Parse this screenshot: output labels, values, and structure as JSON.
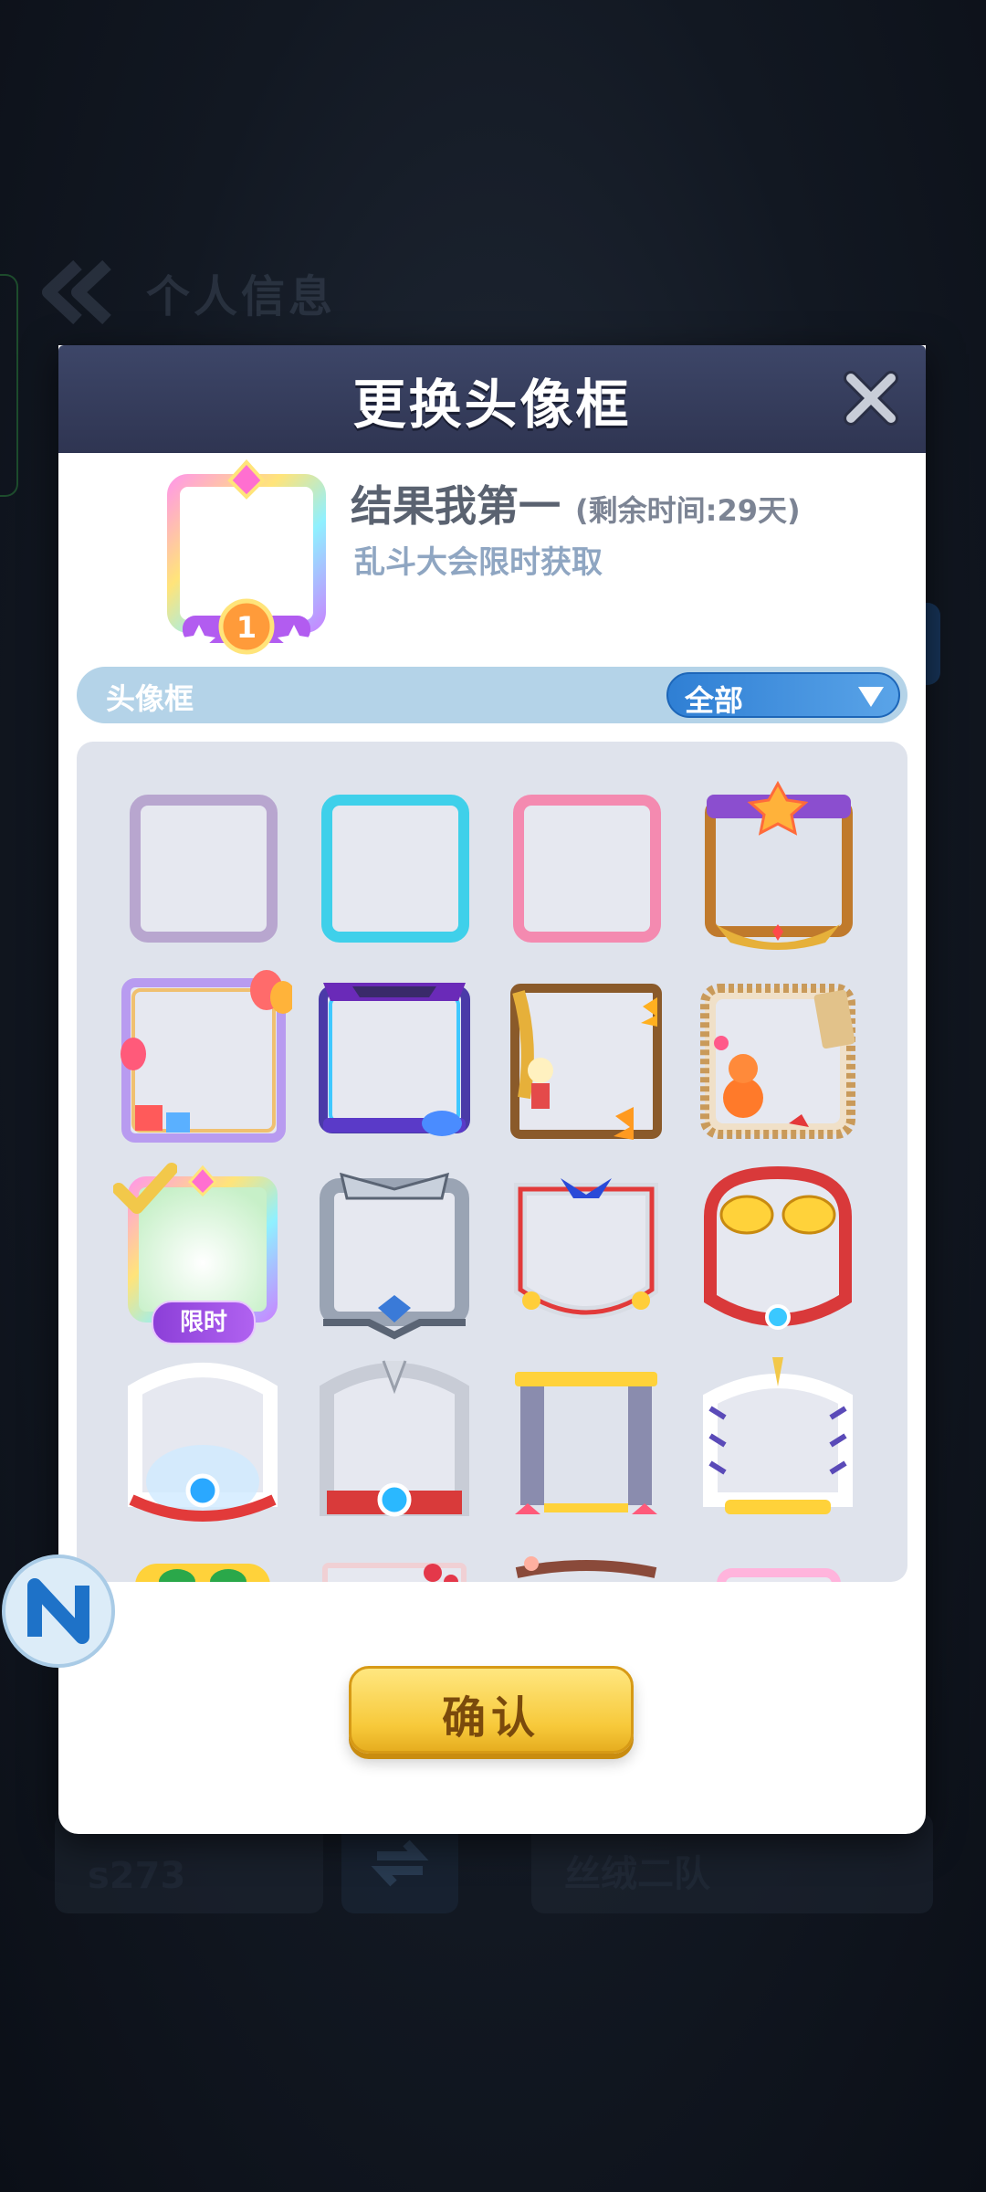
{
  "background": {
    "title": "个人信息",
    "server_value": "s273",
    "team_value": "丝绒二队"
  },
  "modal": {
    "title": "更换头像框",
    "selected_frame": {
      "name": "结果我第一",
      "remaining": "(剩余时间:29天)",
      "source": "乱斗大会限时获取"
    },
    "filter": {
      "label": "头像框",
      "selected": "全部"
    },
    "limited_badge": "限时",
    "confirm_label": "确认"
  },
  "colors": {
    "header": "#2f3552",
    "accent_blue": "#2f7fd4",
    "confirm_yellow": "#f7c93a",
    "limited_purple": "#8c3fd8"
  }
}
